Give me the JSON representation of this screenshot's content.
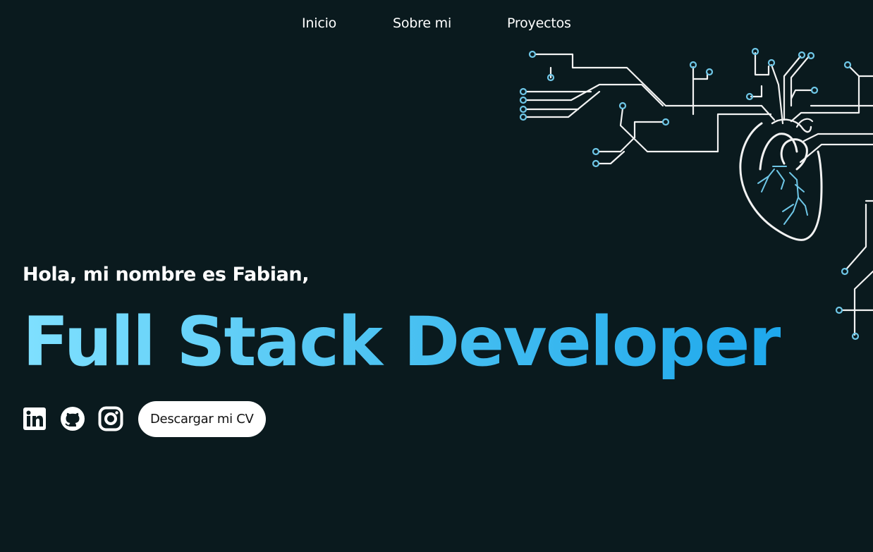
{
  "nav": {
    "items": [
      {
        "label": "Inicio"
      },
      {
        "label": "Sobre mi"
      },
      {
        "label": "Proyectos"
      }
    ]
  },
  "hero": {
    "greeting": "Hola, mi nombre es Fabian,",
    "headline": "Full Stack Developer",
    "cv_button": "Descargar mi CV"
  },
  "social": [
    {
      "icon": "linkedin-icon"
    },
    {
      "icon": "github-icon"
    },
    {
      "icon": "instagram-icon"
    }
  ],
  "colors": {
    "background": "#0a1a1e",
    "accent_start": "#7fe0ff",
    "accent_end": "#1ea8ec",
    "circuit_node": "#6ec6e6",
    "text": "#ffffff"
  },
  "illustration": {
    "icon": "circuit-heart-illustration"
  }
}
